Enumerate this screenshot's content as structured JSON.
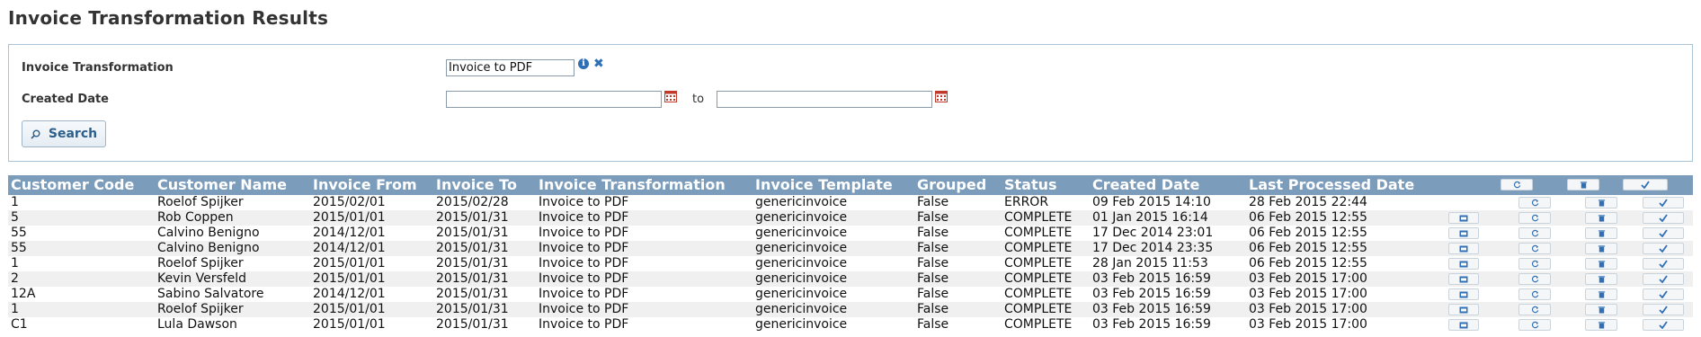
{
  "page": {
    "title": "Invoice Transformation Results"
  },
  "filters": {
    "transformation_label": "Invoice Transformation",
    "transformation_value": "Invoice to PDF",
    "info_glyph": "i",
    "clear_glyph": "✖",
    "created_date_label": "Created Date",
    "date_from_value": "",
    "date_to_value": "",
    "to_label": "to",
    "search_label": "Search",
    "icons": [
      "info-icon",
      "clear-icon",
      "calendar-icon",
      "search-icon"
    ]
  },
  "grid": {
    "header_color": "#7c9cbb",
    "columns": [
      "Customer Code",
      "Customer Name",
      "Invoice From",
      "Invoice To",
      "Invoice Transformation",
      "Invoice Template",
      "Grouped",
      "Status",
      "Created Date",
      "Last Processed Date"
    ],
    "header_actions": [
      "reprocess-all-icon",
      "delete-all-icon",
      "approve-all-icon"
    ],
    "row_actions": [
      "view-icon",
      "reprocess-icon",
      "delete-icon",
      "approve-icon"
    ],
    "rows": [
      {
        "code": "1",
        "name": "Roelof Spijker",
        "from": "2015/02/01",
        "to": "2015/02/28",
        "transformation": "Invoice to PDF",
        "template": "genericinvoice",
        "grouped": "False",
        "status": "ERROR",
        "created": "09 Feb 2015 14:10",
        "processed": "28 Feb 2015 22:44"
      },
      {
        "code": "5",
        "name": "Rob Coppen",
        "from": "2015/01/01",
        "to": "2015/01/31",
        "transformation": "Invoice to PDF",
        "template": "genericinvoice",
        "grouped": "False",
        "status": "COMPLETE",
        "created": "01 Jan 2015 16:14",
        "processed": "06 Feb 2015 12:55"
      },
      {
        "code": "55",
        "name": "Calvino Benigno",
        "from": "2014/12/01",
        "to": "2015/01/31",
        "transformation": "Invoice to PDF",
        "template": "genericinvoice",
        "grouped": "False",
        "status": "COMPLETE",
        "created": "17 Dec 2014 23:01",
        "processed": "06 Feb 2015 12:55"
      },
      {
        "code": "55",
        "name": "Calvino Benigno",
        "from": "2014/12/01",
        "to": "2015/01/31",
        "transformation": "Invoice to PDF",
        "template": "genericinvoice",
        "grouped": "False",
        "status": "COMPLETE",
        "created": "17 Dec 2014 23:35",
        "processed": "06 Feb 2015 12:55"
      },
      {
        "code": "1",
        "name": "Roelof Spijker",
        "from": "2015/01/01",
        "to": "2015/01/31",
        "transformation": "Invoice to PDF",
        "template": "genericinvoice",
        "grouped": "False",
        "status": "COMPLETE",
        "created": "28 Jan 2015 11:53",
        "processed": "06 Feb 2015 12:55"
      },
      {
        "code": "2",
        "name": "Kevin Versfeld",
        "from": "2015/01/01",
        "to": "2015/01/31",
        "transformation": "Invoice to PDF",
        "template": "genericinvoice",
        "grouped": "False",
        "status": "COMPLETE",
        "created": "03 Feb 2015 16:59",
        "processed": "03 Feb 2015 17:00"
      },
      {
        "code": "12A",
        "name": "Sabino Salvatore",
        "from": "2014/12/01",
        "to": "2015/01/31",
        "transformation": "Invoice to PDF",
        "template": "genericinvoice",
        "grouped": "False",
        "status": "COMPLETE",
        "created": "03 Feb 2015 16:59",
        "processed": "03 Feb 2015 17:00"
      },
      {
        "code": "1",
        "name": "Roelof Spijker",
        "from": "2015/01/01",
        "to": "2015/01/31",
        "transformation": "Invoice to PDF",
        "template": "genericinvoice",
        "grouped": "False",
        "status": "COMPLETE",
        "created": "03 Feb 2015 16:59",
        "processed": "03 Feb 2015 17:00"
      },
      {
        "code": "C1",
        "name": "Lula Dawson",
        "from": "2015/01/01",
        "to": "2015/01/31",
        "transformation": "Invoice to PDF",
        "template": "genericinvoice",
        "grouped": "False",
        "status": "COMPLETE",
        "created": "03 Feb 2015 16:59",
        "processed": "03 Feb 2015 17:00"
      }
    ]
  }
}
